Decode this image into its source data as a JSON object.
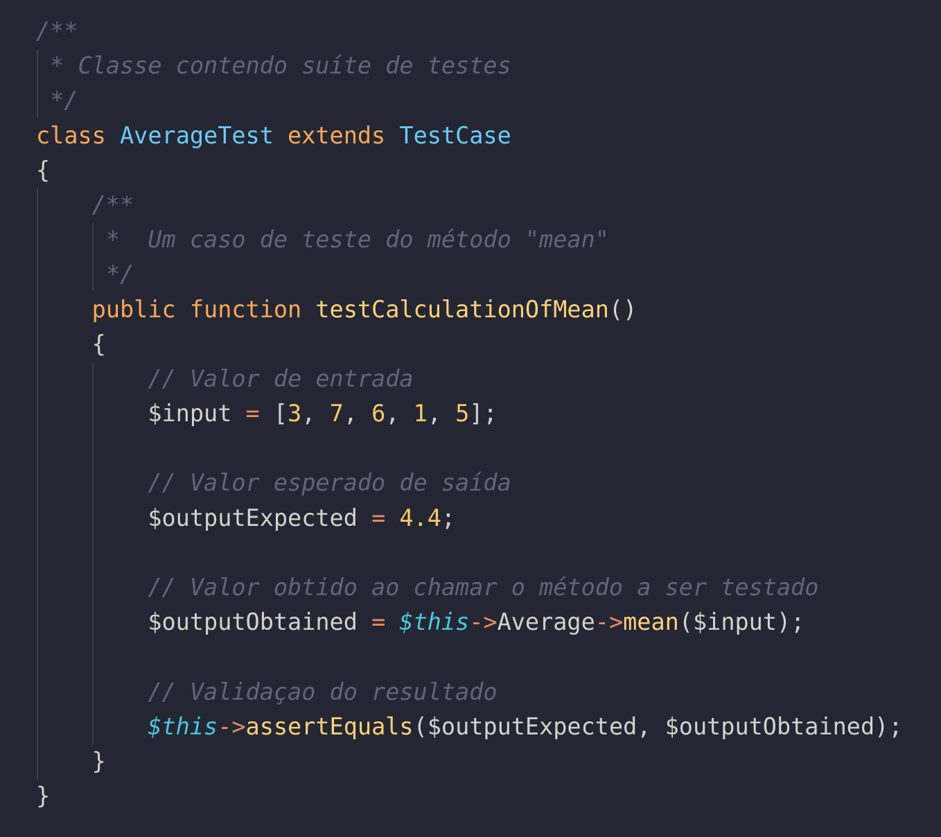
{
  "code_lines": [
    [
      [
        "cm",
        "/**"
      ]
    ],
    [
      [
        "cm",
        " * Classe contendo suíte de testes"
      ]
    ],
    [
      [
        "cm",
        " */"
      ]
    ],
    [
      [
        "kw",
        "class "
      ],
      [
        "cls",
        "AverageTest "
      ],
      [
        "kw",
        "extends "
      ],
      [
        "cls",
        "TestCase"
      ]
    ],
    [
      [
        "tx",
        "{"
      ]
    ],
    [
      [
        "cm",
        "    /**"
      ]
    ],
    [
      [
        "cm",
        "     *  Um caso de teste do método \"mean\""
      ]
    ],
    [
      [
        "cm",
        "     */"
      ]
    ],
    [
      [
        "kw",
        "    public function "
      ],
      [
        "fn",
        "testCalculationOfMean"
      ],
      [
        "tx",
        "()"
      ]
    ],
    [
      [
        "tx",
        "    {"
      ]
    ],
    [
      [
        "cm",
        "        // Valor de entrada"
      ]
    ],
    [
      [
        "tx",
        "        $input "
      ],
      [
        "op",
        "= "
      ],
      [
        "tx",
        "["
      ],
      [
        "num",
        "3"
      ],
      [
        "tx",
        ", "
      ],
      [
        "num",
        "7"
      ],
      [
        "tx",
        ", "
      ],
      [
        "num",
        "6"
      ],
      [
        "tx",
        ", "
      ],
      [
        "num",
        "1"
      ],
      [
        "tx",
        ", "
      ],
      [
        "num",
        "5"
      ],
      [
        "tx",
        "];"
      ]
    ],
    [],
    [
      [
        "cm",
        "        // Valor esperado de saída"
      ]
    ],
    [
      [
        "tx",
        "        $outputExpected "
      ],
      [
        "op",
        "= "
      ],
      [
        "num",
        "4.4"
      ],
      [
        "tx",
        ";"
      ]
    ],
    [],
    [
      [
        "cm",
        "        // Valor obtido ao chamar o método a ser testado"
      ]
    ],
    [
      [
        "tx",
        "        $outputObtained "
      ],
      [
        "op",
        "= "
      ],
      [
        "this",
        "$this"
      ],
      [
        "op",
        "->"
      ],
      [
        "tx",
        "Average"
      ],
      [
        "op",
        "->"
      ],
      [
        "fn",
        "mean"
      ],
      [
        "tx",
        "($input);"
      ]
    ],
    [],
    [
      [
        "cm",
        "        // Validaçao do resultado"
      ]
    ],
    [
      [
        "this",
        "        $this"
      ],
      [
        "op",
        "->"
      ],
      [
        "fn",
        "assertEquals"
      ],
      [
        "tx",
        "($outputExpected, $outputObtained);"
      ]
    ],
    [
      [
        "tx",
        "    }"
      ]
    ],
    [
      [
        "tx",
        "}"
      ]
    ]
  ]
}
